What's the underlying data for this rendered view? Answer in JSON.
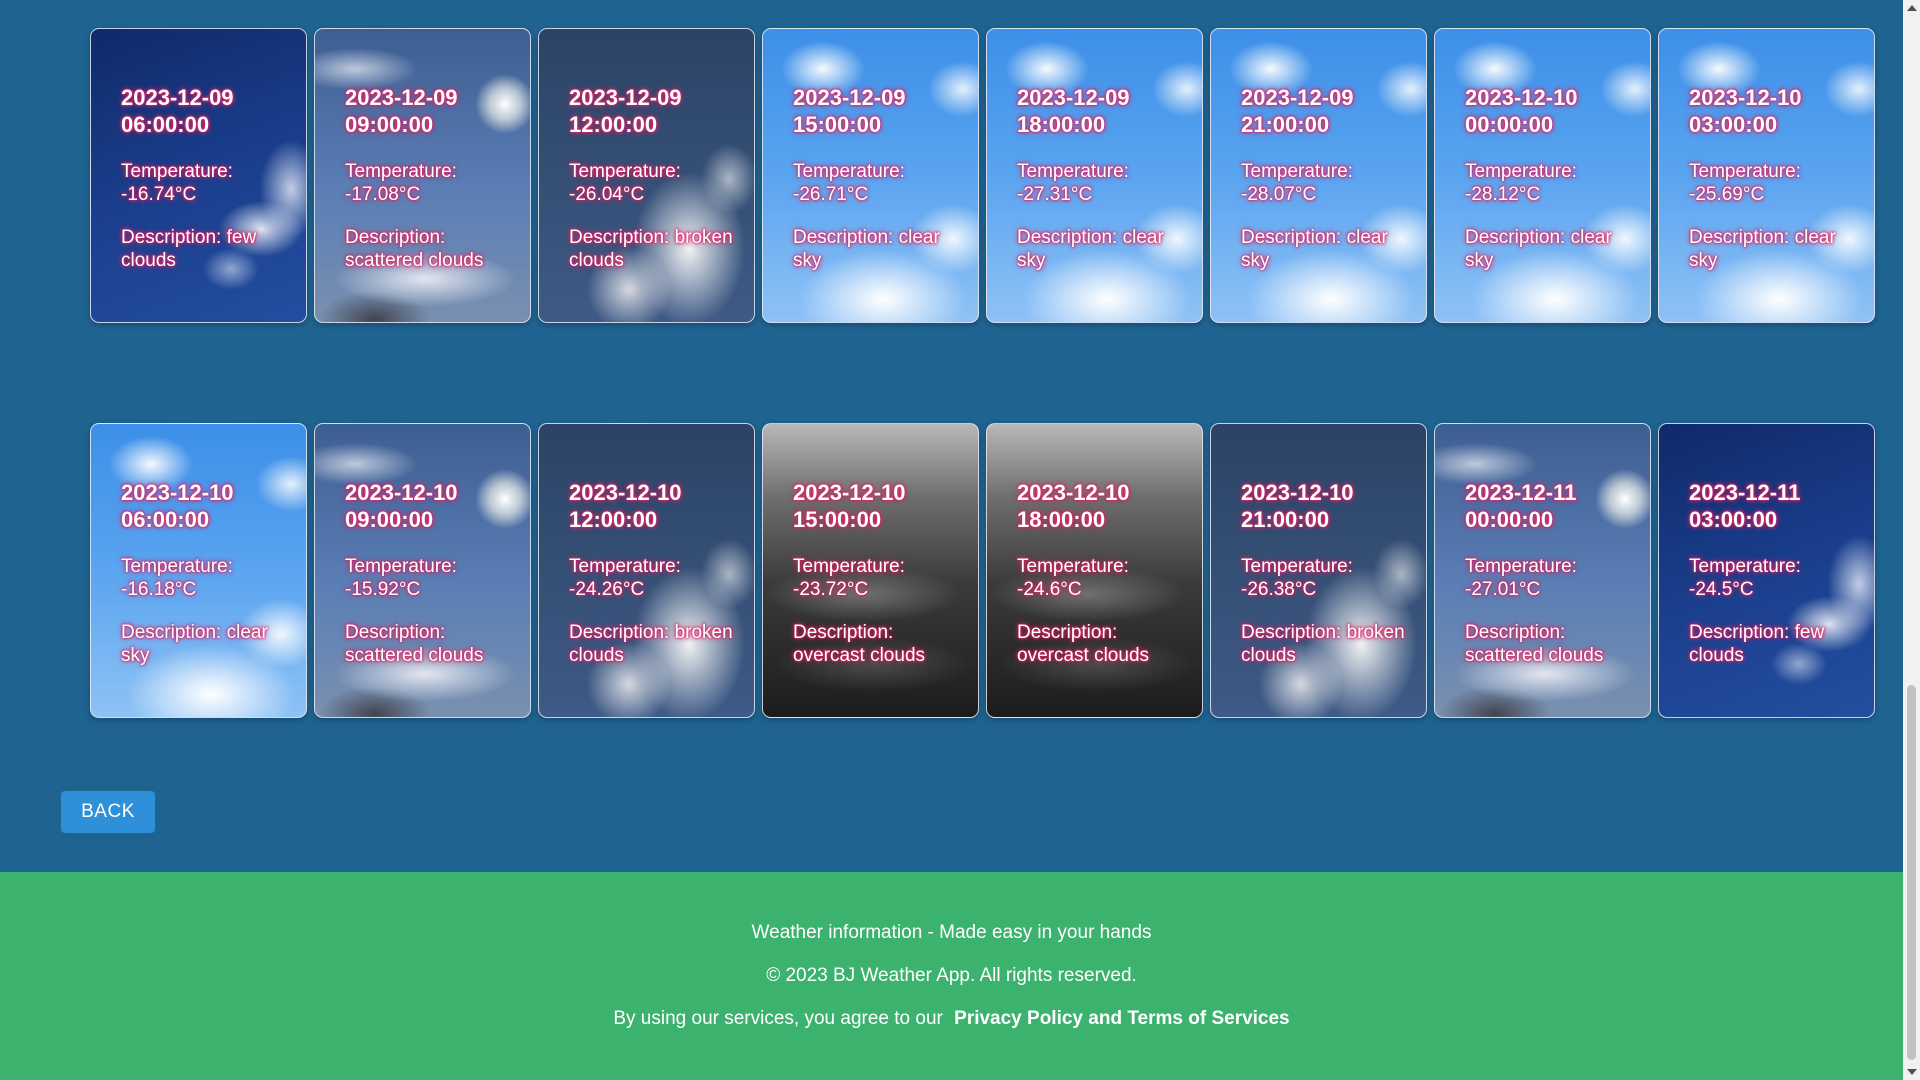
{
  "forecasts": [
    {
      "date": "2023-12-09",
      "time": "06:00:00",
      "temperature": "Temperature: -16.74°C",
      "description": "Description: few clouds",
      "bg": "few-clouds"
    },
    {
      "date": "2023-12-09",
      "time": "09:00:00",
      "temperature": "Temperature: -17.08°C",
      "description": "Description: scattered clouds",
      "bg": "scattered-clouds"
    },
    {
      "date": "2023-12-09",
      "time": "12:00:00",
      "temperature": "Temperature: -26.04°C",
      "description": "Description: broken clouds",
      "bg": "broken-clouds"
    },
    {
      "date": "2023-12-09",
      "time": "15:00:00",
      "temperature": "Temperature: -26.71°C",
      "description": "Description: clear sky",
      "bg": "clear-sky"
    },
    {
      "date": "2023-12-09",
      "time": "18:00:00",
      "temperature": "Temperature: -27.31°C",
      "description": "Description: clear sky",
      "bg": "clear-sky"
    },
    {
      "date": "2023-12-09",
      "time": "21:00:00",
      "temperature": "Temperature: -28.07°C",
      "description": "Description: clear sky",
      "bg": "clear-sky"
    },
    {
      "date": "2023-12-10",
      "time": "00:00:00",
      "temperature": "Temperature: -28.12°C",
      "description": "Description: clear sky",
      "bg": "clear-sky"
    },
    {
      "date": "2023-12-10",
      "time": "03:00:00",
      "temperature": "Temperature: -25.69°C",
      "description": "Description: clear sky",
      "bg": "clear-sky"
    },
    {
      "date": "2023-12-10",
      "time": "06:00:00",
      "temperature": "Temperature: -16.18°C",
      "description": "Description: clear sky",
      "bg": "clear-sky"
    },
    {
      "date": "2023-12-10",
      "time": "09:00:00",
      "temperature": "Temperature: -15.92°C",
      "description": "Description: scattered clouds",
      "bg": "scattered-clouds"
    },
    {
      "date": "2023-12-10",
      "time": "12:00:00",
      "temperature": "Temperature: -24.26°C",
      "description": "Description: broken clouds",
      "bg": "broken-clouds"
    },
    {
      "date": "2023-12-10",
      "time": "15:00:00",
      "temperature": "Temperature: -23.72°C",
      "description": "Description: overcast clouds",
      "bg": "overcast-clouds"
    },
    {
      "date": "2023-12-10",
      "time": "18:00:00",
      "temperature": "Temperature: -24.6°C",
      "description": "Description: overcast clouds",
      "bg": "overcast-clouds"
    },
    {
      "date": "2023-12-10",
      "time": "21:00:00",
      "temperature": "Temperature: -26.38°C",
      "description": "Description: broken clouds",
      "bg": "broken-clouds"
    },
    {
      "date": "2023-12-11",
      "time": "00:00:00",
      "temperature": "Temperature: -27.01°C",
      "description": "Description: scattered clouds",
      "bg": "scattered-clouds"
    },
    {
      "date": "2023-12-11",
      "time": "03:00:00",
      "temperature": "Temperature: -24.5°C",
      "description": "Description: few clouds",
      "bg": "few-clouds"
    }
  ],
  "back_button": {
    "label": "BACK"
  },
  "footer": {
    "tagline": "Weather information - Made easy in your hands",
    "copyright": "© 2023 BJ Weather App. All rights reserved.",
    "agreement": "By using our services, you agree to our",
    "policy_link": "Privacy Policy and Terms of Services"
  },
  "colors": {
    "page_background": "#1f6391",
    "footer_background": "#3bb36f",
    "button_background": "#2e90d8",
    "text_glow": "#e0246a"
  }
}
